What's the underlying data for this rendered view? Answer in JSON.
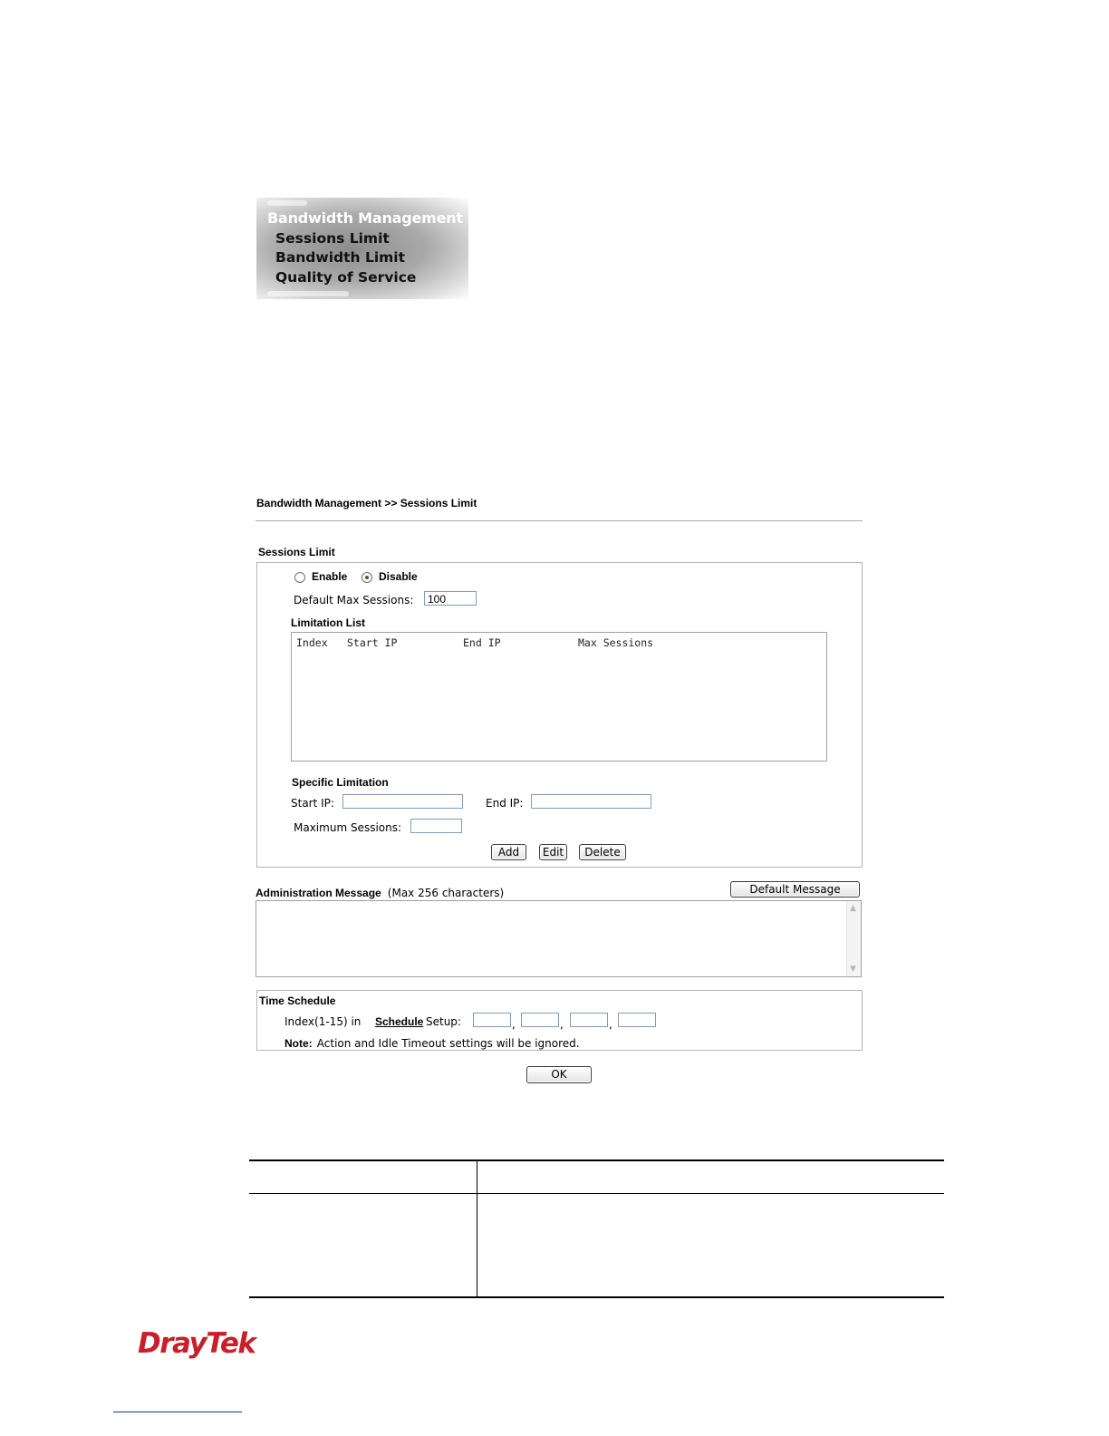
{
  "menu": {
    "title": "Bandwidth Management",
    "items": [
      "Sessions Limit",
      "Bandwidth Limit",
      "Quality of Service"
    ]
  },
  "screen": {
    "breadcrumb": "Bandwidth Management >> Sessions Limit",
    "sessions_limit": {
      "section_title": "Sessions Limit",
      "enable_label": "Enable",
      "disable_label": "Disable",
      "selected": "Disable",
      "default_max_label": "Default Max Sessions:",
      "default_max_value": "100",
      "limitation_list_title": "Limitation List",
      "list_columns": [
        "Index",
        "Start IP",
        "End IP",
        "Max Sessions"
      ],
      "specific_title": "Specific Limitation",
      "start_ip_label": "Start IP:",
      "end_ip_label": "End IP:",
      "max_sessions_label": "Maximum Sessions:",
      "buttons": {
        "add": "Add",
        "edit": "Edit",
        "delete": "Delete"
      }
    },
    "admin_message": {
      "title": "Administration Message",
      "hint": "(Max 256 characters)",
      "default_button": "Default Message"
    },
    "time_schedule": {
      "title": "Time Schedule",
      "index_prefix": "Index(1-15) in",
      "schedule_link": "Schedule",
      "index_suffix": "Setup:",
      "note_label": "Note:",
      "note_text": "Action and Idle Timeout settings will be ignored."
    },
    "ok_button": "OK"
  },
  "footer": {
    "logo": "DrayTek"
  },
  "colors": {
    "logo_red": "#c8202a",
    "panel_border": "#b5b5b5",
    "input_border": "#7f9db9"
  }
}
